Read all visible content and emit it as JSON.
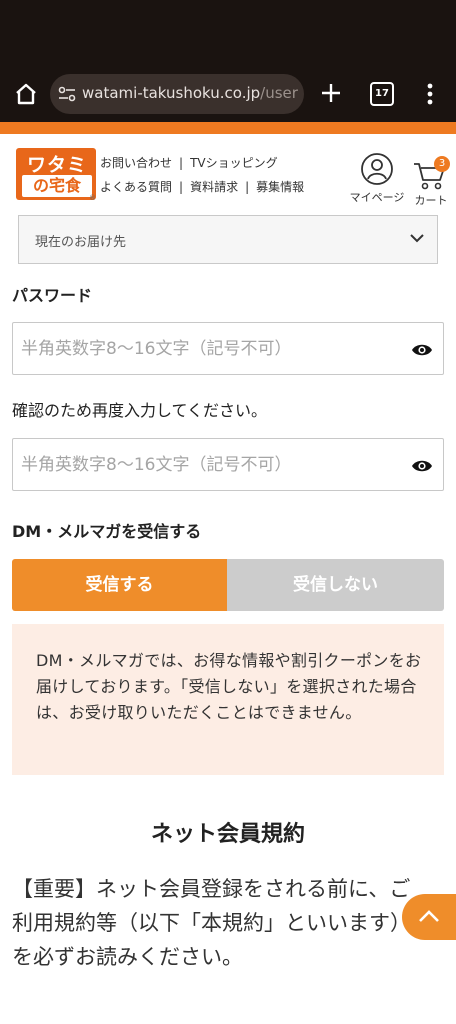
{
  "browser": {
    "url_host": "watami-takushoku.co.jp",
    "url_path": "/user",
    "tab_count": "17"
  },
  "header": {
    "logo_line1": "ワタミ",
    "logo_line2": "の宅食",
    "registered_mark": "®",
    "links_row1": [
      "お問い合わせ",
      "TVショッピング"
    ],
    "links_row2": [
      "よくある質問",
      "資料請求",
      "募集情報"
    ],
    "separator": "|",
    "mypage_label": "マイページ",
    "cart_label": "カート",
    "cart_count": "3"
  },
  "delivery": {
    "label": "現在のお届け先"
  },
  "form": {
    "password_label": "パスワード",
    "password_placeholder": "半角英数字8～16文字（記号不可）",
    "confirm_label": "確認のため再度入力してください。",
    "confirm_placeholder": "半角英数字8～16文字（記号不可）",
    "dm_label": "DM・メルマガを受信する",
    "dm_on": "受信する",
    "dm_off": "受信しない",
    "dm_selected": "受信する",
    "dm_notice": "DM・メルマガでは、お得な情報や割引クーポンをお届けしております。「受信しない」を選択された場合は、お受け取りいただくことはできません。"
  },
  "terms": {
    "title": "ネット会員規約",
    "body": "【重要】ネット会員登録をされる前に、ご利用規約等（以下「本規約」といいます）を必ずお読みください。"
  },
  "colors": {
    "accent": "#ee7a21",
    "toggle_on": "#ef8d2a",
    "toggle_off": "#cccccc",
    "notice_bg": "#fdede4",
    "chrome_bg": "#1a1310"
  },
  "icons": [
    "home-icon",
    "site-settings-icon",
    "plus-icon",
    "tab-switcher-icon",
    "more-vert-icon",
    "user-icon",
    "cart-icon",
    "chevron-down-icon",
    "eye-icon",
    "chevron-up-icon"
  ]
}
